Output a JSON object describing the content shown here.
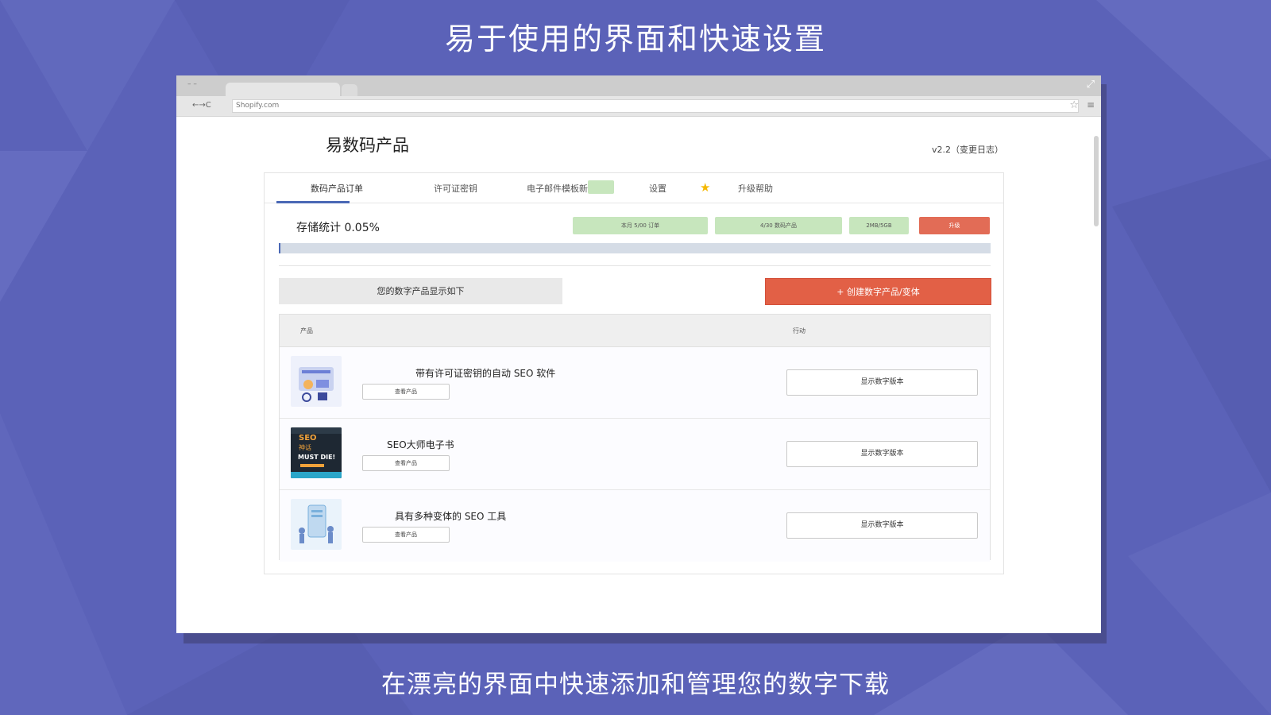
{
  "headline": "易于使用的界面和快速设置",
  "footline": "在漂亮的界面中快速添加和管理您的数字下载",
  "browser": {
    "url": "Shopify.com",
    "nav": "←→C"
  },
  "app": {
    "title": "易数码产品",
    "version": "v2.2（变更日志）"
  },
  "tabs": [
    {
      "label": "数码产品订单",
      "active": true
    },
    {
      "label": "许可证密钥",
      "active": false
    },
    {
      "label": "电子邮件模板新",
      "active": false
    },
    {
      "label": "设置",
      "active": false
    },
    {
      "label": "升级帮助",
      "active": false
    }
  ],
  "storage": {
    "label": "存储统计 0.05%",
    "percent": 0.05,
    "stats": [
      "本月 5/00 订单",
      "4/30 数码产品",
      "2MB/5GB"
    ],
    "upgrade": "升级"
  },
  "list": {
    "info": "您的数字产品显示如下",
    "create": "+ 创建数字产品/变体",
    "col_product": "产品",
    "col_action": "行动",
    "rows": [
      {
        "name": "带有许可证密钥的自动 SEO 软件",
        "view": "查看产品",
        "show": "显示数字版本"
      },
      {
        "name": "SEO大师电子书",
        "view": "查看产品",
        "show": "显示数字版本"
      },
      {
        "name": "具有多种变体的 SEO 工具",
        "view": "查看产品",
        "show": "显示数字版本"
      }
    ]
  },
  "thumb2": {
    "line1": "SEO",
    "line2": "神话",
    "line3": "MUST DIE!"
  },
  "colors": {
    "accent": "#4a68b5",
    "danger": "#e26046",
    "success": "#c7e6bd",
    "background": "#5b62b8"
  }
}
